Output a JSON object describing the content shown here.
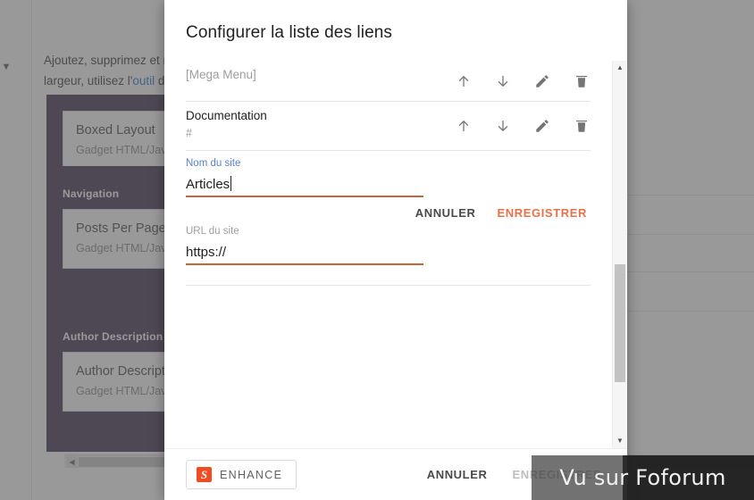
{
  "background": {
    "description_line1": "Ajoutez, supprimez et modifiez les gadgets sur votre blog. Cliquez sur le bouton Modifier pour modifier la",
    "description_line2_pre": "largeur, utilisez l'",
    "description_link": "outil",
    "description_line2_post": " de glisser-déposer pour les réagencer.",
    "sections": [
      {
        "title": "",
        "widgets": [
          {
            "name": "Boxed Layout",
            "type": "Gadget HTML/JavaScript"
          }
        ]
      },
      {
        "title": "Navigation",
        "widgets": [
          {
            "name": "Posts Per Page",
            "type": "Gadget HTML/JavaScript"
          }
        ]
      },
      {
        "title": "Author Description",
        "widgets": [
          {
            "name": "Author Description",
            "type": "Gadget HTML/JavaScript"
          }
        ]
      }
    ],
    "hscroll_left_arrow": "◀",
    "collapse_caret": "▼"
  },
  "dialog": {
    "title": "Configurer la liste des liens",
    "link_rows": [
      {
        "name": "[Mega Menu]",
        "url": "",
        "name_is_placeholder": true
      },
      {
        "name": "Documentation",
        "url": "#",
        "name_is_placeholder": false
      }
    ],
    "row_actions": [
      {
        "icon": "arrow-up-icon",
        "label": "Déplacer vers le haut"
      },
      {
        "icon": "arrow-down-icon",
        "label": "Déplacer vers le bas"
      },
      {
        "icon": "pencil-icon",
        "label": "Modifier"
      },
      {
        "icon": "trash-icon",
        "label": "Supprimer"
      }
    ],
    "form": {
      "name_label": "Nom du site",
      "name_value": "Articles",
      "url_label": "URL du site",
      "url_value": "https://",
      "inline_cancel": "ANNULER",
      "inline_save": "ENREGISTRER"
    },
    "footer": {
      "enhance_label": "ENHANCE",
      "enhance_logo_letter": "S",
      "cancel_label": "ANNULER",
      "save_label": "ENREGISTRER"
    },
    "scrollbar": {
      "up_arrow": "▲",
      "down_arrow": "▼"
    }
  },
  "watermark": {
    "text": "Vu sur Foforum"
  },
  "colors": {
    "accent_orange": "#e8714a",
    "underline_orange": "#c1663a",
    "label_blue": "#5b7fc7",
    "panel_purple": "#3b2a4d",
    "enhance_red": "#f04b22"
  }
}
